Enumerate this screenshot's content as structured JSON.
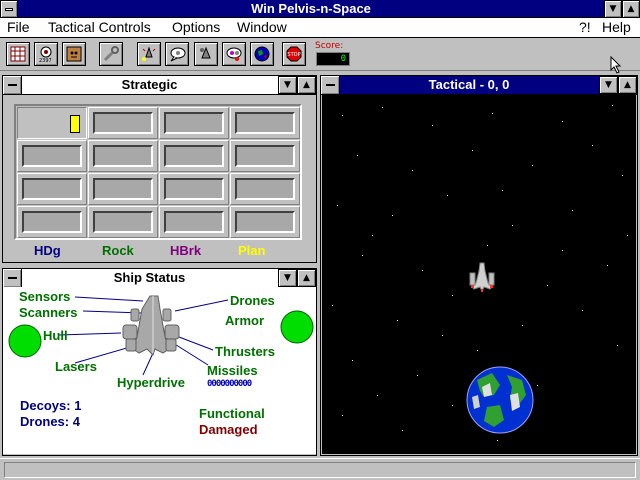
{
  "window": {
    "title": "Win Pelvis-n-Space"
  },
  "menu": {
    "file": "File",
    "tactical": "Tactical Controls",
    "options": "Options",
    "window": "Window",
    "help_q": "?!",
    "help": "Help"
  },
  "toolbar": {
    "score_label": "Score:",
    "score_value": "0",
    "tools": [
      "grid-icon",
      "calendar-icon",
      "monster-icon",
      "wrench-icon",
      "ship-star-icon",
      "speech-icon",
      "move-icon",
      "radar-icon",
      "planet-icon",
      "stop-icon"
    ]
  },
  "strategic": {
    "title": "Strategic",
    "legend": [
      {
        "label": "HDg",
        "color": "#000080"
      },
      {
        "label": "Rock",
        "color": "#007000"
      },
      {
        "label": "HBrk",
        "color": "#800080"
      },
      {
        "label": "Plan",
        "color": "#ffff00"
      }
    ]
  },
  "ship_status": {
    "title": "Ship Status",
    "labels": {
      "sensors": "Sensors",
      "scanners": "Scanners",
      "hull": "Hull",
      "lasers": "Lasers",
      "hyperdrive": "Hyperdrive",
      "drones": "Drones",
      "armor": "Armor",
      "thrusters": "Thrusters",
      "missiles": "Missiles"
    },
    "missile_ammo": "0000000000",
    "decoys": "Decoys: 1",
    "drones_count": "Drones: 4",
    "legend_functional": "Functional",
    "legend_damaged": "Damaged"
  },
  "tactical": {
    "title": "Tactical - 0, 0"
  },
  "colors": {
    "titlebar_active": "#000080",
    "functional": "#007000",
    "damaged": "#800000",
    "status_ok": "#00c000"
  }
}
